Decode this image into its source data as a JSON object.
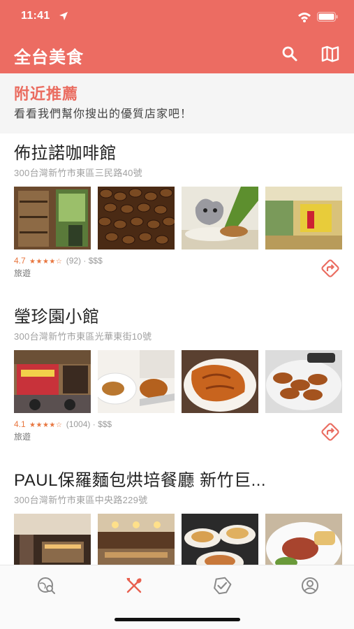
{
  "status_bar": {
    "time": "11:41"
  },
  "app_bar": {
    "title": "全台美食",
    "search_icon": "search-icon",
    "map_icon": "map-icon",
    "bar_color": "#ec6c62"
  },
  "section": {
    "title": "附近推薦",
    "subtitle": "看看我們幫你搜出的優質店家吧！"
  },
  "restaurants": [
    {
      "name": "佈拉諾咖啡館",
      "address": "300台灣新竹市東區三民路40號",
      "rating": "4.7",
      "stars": "★★★★☆",
      "reviews": "(92)",
      "price": "$$$",
      "category": "旅遊"
    },
    {
      "name": "瑩珍園小館",
      "address": "300台灣新竹市東區光華東街10號",
      "rating": "4.1",
      "stars": "★★★★☆",
      "reviews": "(1004)",
      "price": "$$$",
      "category": "旅遊"
    },
    {
      "name": "PAUL保羅麵包烘培餐廳 新竹巨...",
      "address": "300台灣新竹市東區中央路229號"
    }
  ],
  "tab_bar": {
    "tabs": [
      "explore-icon",
      "utensils-icon",
      "badge-check-icon",
      "profile-icon"
    ],
    "active_index": 1,
    "active_color": "#e8604f",
    "inactive_color": "#8a8a8a"
  },
  "accent_color": "#e8763f"
}
